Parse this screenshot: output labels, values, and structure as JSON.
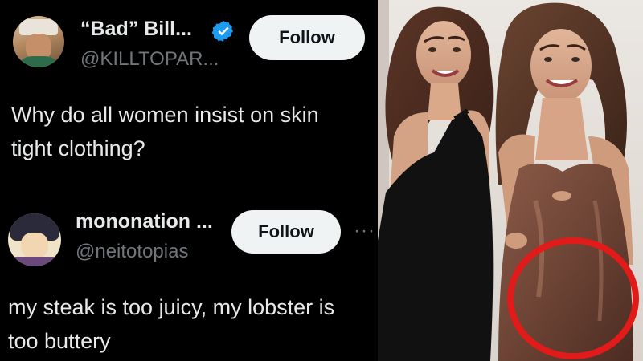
{
  "posts": [
    {
      "display_name": "“Bad” Bill...",
      "handle": "@KILLTOPAR...",
      "verified": true,
      "follow_label": "Follow",
      "text": "Why do all women insist on skin\ntight clothing?",
      "avatar_icon": "cowboy-avatar-icon"
    },
    {
      "display_name": "mononation ...",
      "handle": "@neitotopias",
      "verified": false,
      "follow_label": "Follow",
      "more_label": "···",
      "text": "my steak is too juicy, my lobster is\ntoo buttery",
      "avatar_icon": "anime-avatar-icon"
    }
  ],
  "colors": {
    "background": "#000000",
    "text_primary": "#e7e9ea",
    "text_secondary": "#71767b",
    "follow_bg": "#eff3f4",
    "follow_text": "#0f1419",
    "verified_blue": "#1d9bf0",
    "highlight_circle": "#e11a1a"
  },
  "photo": {
    "description_icon": "photo-two-women-icon",
    "highlight_icon": "red-circle-highlight-icon"
  }
}
